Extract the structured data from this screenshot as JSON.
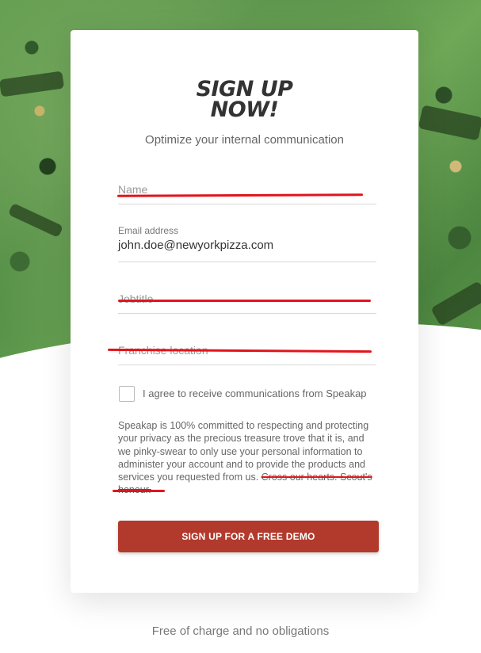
{
  "form": {
    "title_line1": "SIGN UP",
    "title_line2": "NOW!",
    "subtitle": "Optimize your internal communication",
    "fields": {
      "name_placeholder": "Name",
      "email_label": "Email address",
      "email_value": "john.doe@newyorkpizza.com",
      "jobtitle_placeholder": "Jobtitle",
      "franchise_placeholder": "Franchise location"
    },
    "consent_label": "I agree to receive communications from Speakap",
    "privacy_text": "Speakap is 100% committed to respecting and protecting your privacy as the precious treasure trove that it is, and we pinky-swear to only use your personal information to administer your account and to provide the products and services you requested from us.",
    "privacy_struck": "Cross our hearts. Scout's honour.",
    "cta_label": "SIGN UP FOR A FREE DEMO"
  },
  "footer_note": "Free of charge and no obligations",
  "colors": {
    "cta": "#b23a2c",
    "annotation": "#e2141c"
  }
}
